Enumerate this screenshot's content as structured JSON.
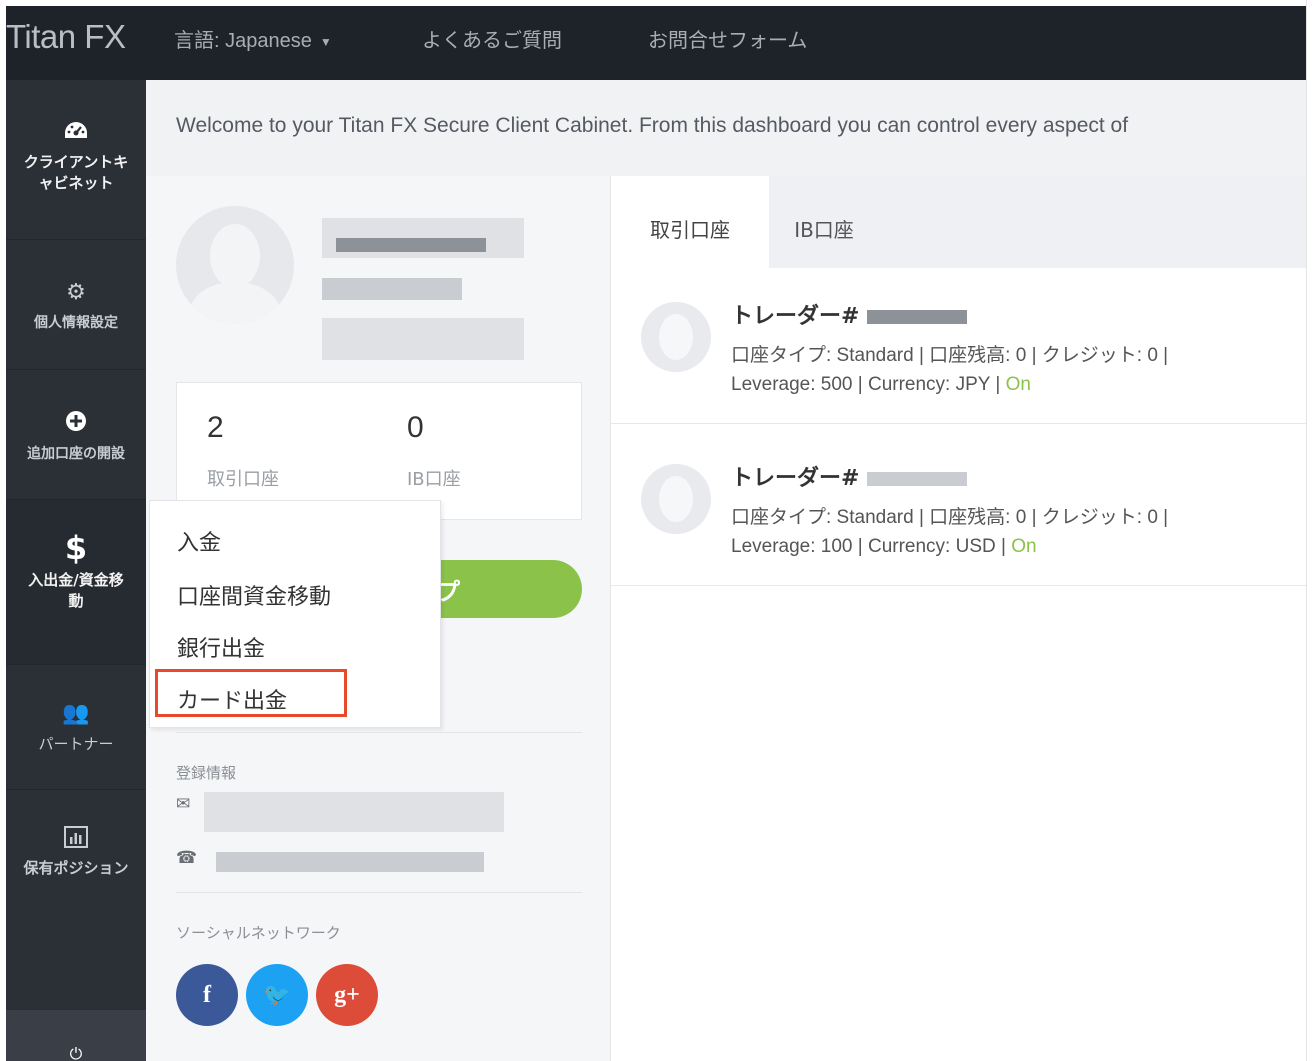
{
  "topbar": {
    "brand": "Titan FX",
    "language": "言語: Japanese",
    "faq": "よくあるご質問",
    "contact": "お問合せフォーム"
  },
  "sidebar": {
    "items": [
      {
        "line1": "クライアントキ",
        "line2": "ャビネット",
        "icon": "dashboard-icon"
      },
      {
        "line1": "個人情報設定",
        "icon": "gears-icon"
      },
      {
        "line1": "追加口座の開設",
        "icon": "plus-circle-icon"
      },
      {
        "line1": "入出金/資金移",
        "line2": "動",
        "icon": "dollar-icon"
      },
      {
        "line1": "パートナー",
        "icon": "users-icon"
      },
      {
        "line1": "保有ポジション",
        "icon": "bar-chart-icon"
      }
    ],
    "power_icon": "power-icon"
  },
  "welcome": "Welcome to your Titan FX Secure Client Cabinet. From this dashboard you can control every aspect of",
  "profile": {
    "stats": [
      {
        "value": "2",
        "label": "取引口座"
      },
      {
        "value": "0",
        "label": "IB口座"
      }
    ],
    "button_fragment": "プ",
    "registration_label": "登録情報",
    "social_label": "ソーシャルネットワーク",
    "social": [
      {
        "glyph": "f",
        "name": "facebook-icon",
        "color": "#3b5998"
      },
      {
        "glyph": "🐦",
        "name": "twitter-icon",
        "color": "#1da1f2"
      },
      {
        "glyph": "g+",
        "name": "google-plus-icon",
        "color": "#dd4b39"
      }
    ]
  },
  "dropdown": {
    "items": [
      "入金",
      "口座間資金移動",
      "銀行出金",
      "カード出金"
    ],
    "highlighted": "カード出金"
  },
  "accounts": {
    "tabs": [
      "取引口座",
      "IB口座"
    ],
    "list": [
      {
        "title": "トレーダー#",
        "line1": "口座タイプ: Standard | 口座残高: 0 | クレジット: 0 |",
        "line2_prefix": "Leverage: 500 | Currency: JPY | ",
        "status": "On"
      },
      {
        "title": "トレーダー#",
        "line1": "口座タイプ: Standard | 口座残高: 0 | クレジット: 0 |",
        "line2_prefix": "Leverage: 100 | Currency: USD | ",
        "status": "On"
      }
    ]
  },
  "colors": {
    "topbar": "#1e2229",
    "sidebar": "#2b2f36",
    "accent_green": "#8bc34a",
    "highlight_red": "#e64a2b"
  }
}
